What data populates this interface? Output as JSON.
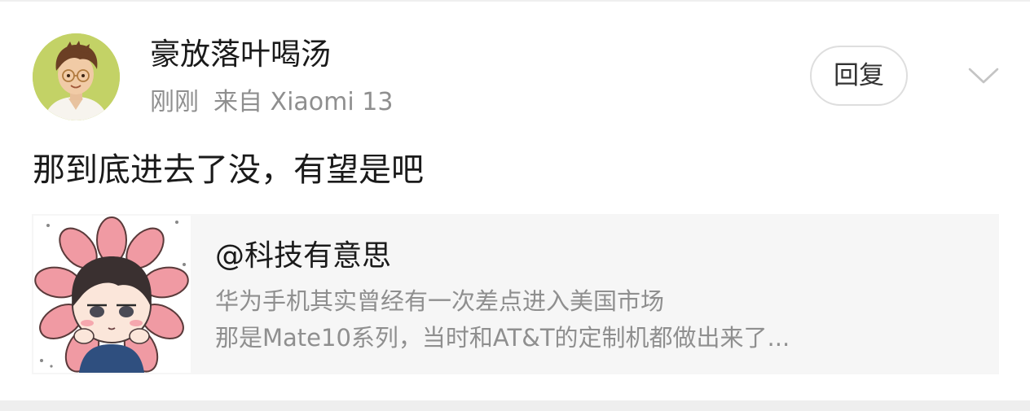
{
  "comment": {
    "author": "豪放落叶喝汤",
    "time": "刚刚",
    "source": "来自 Xiaomi 13",
    "text": "那到底进去了没，有望是吧",
    "reply_label": "回复"
  },
  "quote": {
    "author": "@科技有意思",
    "line1": "华为手机其实曾经有一次差点进入美国市场",
    "line2": "那是Mate10系列，当时和AT&T的定制机都做出来了..."
  },
  "icons": {
    "expand": "chevron-down-icon",
    "avatar": "cartoon-man-with-glasses",
    "quote_thumbnail": "cartoon-child-in-pink-flower"
  },
  "colors": {
    "text_primary": "#1a1a1a",
    "text_secondary": "#8f8f8f",
    "card_background": "#f6f6f6",
    "button_border": "#dedede",
    "divider": "#eeeeee"
  }
}
